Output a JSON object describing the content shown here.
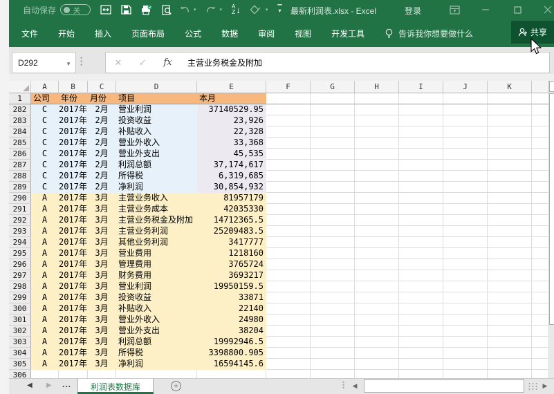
{
  "colors": {
    "green": "#217346",
    "greendark": "#0E5230",
    "dim": "#A3C2B1",
    "outside": "#F3F3F3",
    "fill-header": "#F7B77D",
    "fill-blue": "#E6F1F9",
    "fill-purple": "#ECE9F1",
    "fill-yellow": "#FDF0C6"
  },
  "titlebar": {
    "autosave_label": "自动保存",
    "autosave_state": "关",
    "filename": "最新利润表.xlsx - Excel",
    "signin": "登录"
  },
  "ribbon": {
    "tabs": [
      "文件",
      "开始",
      "插入",
      "页面布局",
      "公式",
      "数据",
      "审阅",
      "视图",
      "开发工具"
    ],
    "tellme": "告诉我你想要做什么",
    "share": "共享"
  },
  "formula_bar": {
    "name_box": "D292",
    "fx": "fx",
    "formula": "主营业务税金及附加"
  },
  "grid": {
    "col_headers": [
      "A",
      "B",
      "C",
      "D",
      "E",
      "F",
      "G",
      "H",
      "I",
      "J",
      "K"
    ],
    "rows": [
      {
        "n": "1",
        "a": "公司",
        "b": "年份",
        "c": "月份",
        "d": "项目",
        "e": "本月",
        "cls": "hdr"
      },
      {
        "n": "282",
        "a": "C",
        "b": "2017年",
        "c": "2月",
        "d": "营业利润",
        "e": "37140529.95",
        "cls": "c"
      },
      {
        "n": "283",
        "a": "C",
        "b": "2017年",
        "c": "2月",
        "d": "投资收益",
        "e": "23,926",
        "cls": "c"
      },
      {
        "n": "284",
        "a": "C",
        "b": "2017年",
        "c": "2月",
        "d": "补贴收入",
        "e": "22,328",
        "cls": "c"
      },
      {
        "n": "285",
        "a": "C",
        "b": "2017年",
        "c": "2月",
        "d": "营业外收入",
        "e": "33,368",
        "cls": "c"
      },
      {
        "n": "286",
        "a": "C",
        "b": "2017年",
        "c": "2月",
        "d": "营业外支出",
        "e": "45,535",
        "cls": "c"
      },
      {
        "n": "287",
        "a": "C",
        "b": "2017年",
        "c": "2月",
        "d": "利润总额",
        "e": "37,174,617",
        "cls": "c"
      },
      {
        "n": "288",
        "a": "C",
        "b": "2017年",
        "c": "2月",
        "d": "所得税",
        "e": "6,319,685",
        "cls": "c"
      },
      {
        "n": "289",
        "a": "C",
        "b": "2017年",
        "c": "2月",
        "d": "净利润",
        "e": "30,854,932",
        "cls": "c"
      },
      {
        "n": "290",
        "a": "A",
        "b": "2017年",
        "c": "3月",
        "d": "主营业务收入",
        "e": "81957179",
        "cls": "a"
      },
      {
        "n": "291",
        "a": "A",
        "b": "2017年",
        "c": "3月",
        "d": "主营业务成本",
        "e": "42035330",
        "cls": "a"
      },
      {
        "n": "292",
        "a": "A",
        "b": "2017年",
        "c": "3月",
        "d": "主营业务税金及附加",
        "e": "14712365.5",
        "cls": "a"
      },
      {
        "n": "293",
        "a": "A",
        "b": "2017年",
        "c": "3月",
        "d": "主营业务利润",
        "e": "25209483.5",
        "cls": "a"
      },
      {
        "n": "294",
        "a": "A",
        "b": "2017年",
        "c": "3月",
        "d": "其他业务利润",
        "e": "3417777",
        "cls": "a"
      },
      {
        "n": "295",
        "a": "A",
        "b": "2017年",
        "c": "3月",
        "d": "营业费用",
        "e": "1218160",
        "cls": "a"
      },
      {
        "n": "296",
        "a": "A",
        "b": "2017年",
        "c": "3月",
        "d": "管理费用",
        "e": "3765724",
        "cls": "a"
      },
      {
        "n": "297",
        "a": "A",
        "b": "2017年",
        "c": "3月",
        "d": "财务费用",
        "e": "3693217",
        "cls": "a"
      },
      {
        "n": "298",
        "a": "A",
        "b": "2017年",
        "c": "3月",
        "d": "营业利润",
        "e": "19950159.5",
        "cls": "a"
      },
      {
        "n": "299",
        "a": "A",
        "b": "2017年",
        "c": "3月",
        "d": "投资收益",
        "e": "33871",
        "cls": "a"
      },
      {
        "n": "300",
        "a": "A",
        "b": "2017年",
        "c": "3月",
        "d": "补贴收入",
        "e": "22140",
        "cls": "a"
      },
      {
        "n": "301",
        "a": "A",
        "b": "2017年",
        "c": "3月",
        "d": "营业外收入",
        "e": "24980",
        "cls": "a"
      },
      {
        "n": "302",
        "a": "A",
        "b": "2017年",
        "c": "3月",
        "d": "营业外支出",
        "e": "38204",
        "cls": "a"
      },
      {
        "n": "303",
        "a": "A",
        "b": "2017年",
        "c": "3月",
        "d": "利润总额",
        "e": "19992946.5",
        "cls": "a"
      },
      {
        "n": "304",
        "a": "A",
        "b": "2017年",
        "c": "3月",
        "d": "所得税",
        "e": "3398800.905",
        "cls": "a"
      },
      {
        "n": "305",
        "a": "A",
        "b": "2017年",
        "c": "3月",
        "d": "净利润",
        "e": "16594145.6",
        "cls": "a"
      },
      {
        "n": "306",
        "a": "",
        "b": "",
        "c": "",
        "d": "",
        "e": "",
        "cls": "empty"
      }
    ]
  },
  "sheet_bar": {
    "ellipsis": "...",
    "tab": "利润表数据库"
  }
}
